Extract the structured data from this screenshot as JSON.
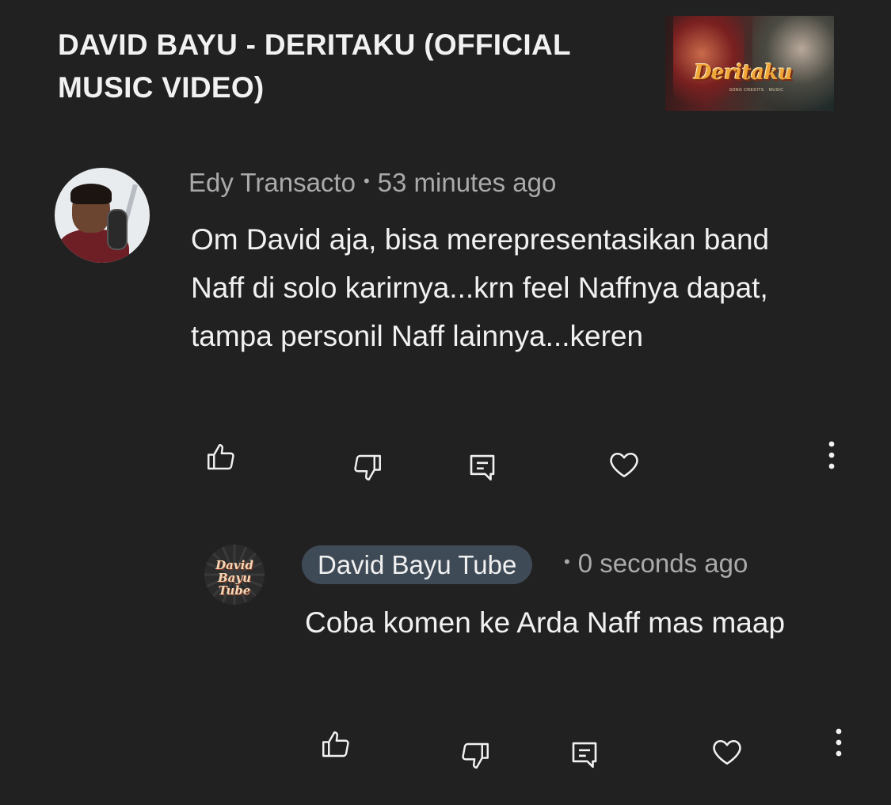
{
  "video": {
    "title": "DAVID BAYU - DERITAKU (OFFICIAL MUSIC VIDEO)",
    "thumbnail_title": "Deritaku",
    "thumbnail_subtitle": "SONG CREDITS · MUSIC"
  },
  "comment": {
    "author": "Edy Transacto",
    "separator": "•",
    "time": "53 minutes ago",
    "text": "Om David aja, bisa merepresentasikan band Naff di solo karirnya...krn feel Naffnya dapat, tampa personil Naff lainnya...keren",
    "actions": [
      "like-icon",
      "dislike-icon",
      "reply-icon",
      "heart-icon",
      "more-icon"
    ]
  },
  "reply": {
    "author": "David Bayu Tube",
    "separator": "•",
    "time": "0 seconds ago",
    "text": "Coba komen ke Arda Naff mas maap",
    "avatar_logo": "David Bayu Tube",
    "actions": [
      "like-icon",
      "dislike-icon",
      "reply-icon",
      "heart-icon",
      "more-icon"
    ]
  },
  "colors": {
    "background": "#212121",
    "text_primary": "#f1f1f1",
    "text_secondary": "#aaaaaa",
    "author_badge": "#3f4a57"
  }
}
